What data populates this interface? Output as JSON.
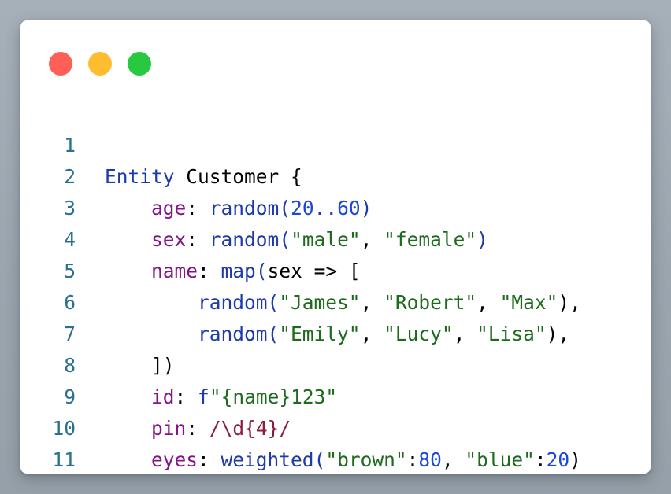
{
  "window": {
    "controls": {
      "close_color": "#ff5f57",
      "minimize_color": "#febc2e",
      "maximize_color": "#28c840"
    }
  },
  "colors": {
    "keyword": "#1c3aa9",
    "property": "#84148a",
    "string": "#1e6b1e",
    "number": "#1b49d6",
    "regex": "#8a1c3c",
    "line_number": "#2a7091",
    "plain": "#000000"
  },
  "code": {
    "line_numbers": [
      "1",
      "2",
      "3",
      "4",
      "5",
      "6",
      "7",
      "8",
      "9",
      "10",
      "11"
    ],
    "l1": {
      "entity": "Entity",
      "name": " Customer ",
      "brace": "{"
    },
    "l2": {
      "indent": "    ",
      "prop": "age",
      "colon": ": ",
      "fn": "random",
      "open": "(",
      "n1": "20",
      "range": "..",
      "n2": "60",
      "close": ")"
    },
    "l3": {
      "indent": "    ",
      "prop": "sex",
      "colon": ": ",
      "fn": "random",
      "open": "(",
      "s1": "\"male\"",
      "sep": ", ",
      "s2": "\"female\"",
      "close": ")"
    },
    "l4": {
      "indent": "    ",
      "prop": "name",
      "colon": ": ",
      "fn": "map",
      "open": "(",
      "rest": "sex => ["
    },
    "l5": {
      "indent": "        ",
      "fn": "random",
      "open": "(",
      "s1": "\"James\"",
      "sep1": ", ",
      "s2": "\"Robert\"",
      "sep2": ", ",
      "s3": "\"Max\"",
      "close": "),"
    },
    "l6": {
      "indent": "        ",
      "fn": "random",
      "open": "(",
      "s1": "\"Emily\"",
      "sep1": ", ",
      "s2": "\"Lucy\"",
      "sep2": ", ",
      "s3": "\"Lisa\"",
      "close": "),"
    },
    "l7": {
      "indent": "    ",
      "text": "])"
    },
    "l8": {
      "indent": "    ",
      "prop": "id",
      "colon": ": ",
      "fmt": "f",
      "str": "\"{name}123\""
    },
    "l9": {
      "indent": "    ",
      "prop": "pin",
      "colon": ": ",
      "rx1": "/",
      "body": "\\d{4}",
      "rx2": "/"
    },
    "l10": {
      "indent": "    ",
      "prop": "eyes",
      "colon": ": ",
      "fn": "weighted",
      "open": "(",
      "s1": "\"brown\"",
      "c1": ":",
      "n1": "80",
      "sep": ", ",
      "s2": "\"blue\"",
      "c2": ":",
      "n2": "20",
      "close": ")"
    },
    "l11": {
      "brace": "}"
    }
  }
}
